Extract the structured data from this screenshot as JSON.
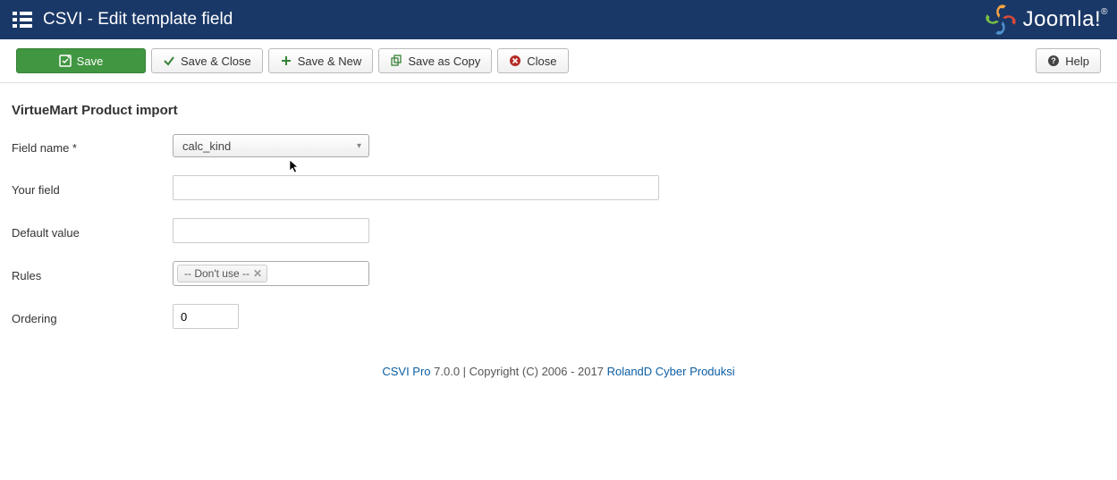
{
  "header": {
    "title": "CSVI - Edit template field",
    "brand": "Joomla!",
    "brand_r": "®"
  },
  "toolbar": {
    "save": "Save",
    "save_close": "Save & Close",
    "save_new": "Save & New",
    "save_copy": "Save as Copy",
    "close": "Close",
    "help": "Help"
  },
  "form": {
    "title": "VirtueMart Product import",
    "field_name_label": "Field name *",
    "field_name_value": "calc_kind",
    "your_field_label": "Your field",
    "your_field_value": "",
    "default_value_label": "Default value",
    "default_value": "",
    "rules_label": "Rules",
    "rules_tag": "-- Don't use --",
    "ordering_label": "Ordering",
    "ordering_value": "0"
  },
  "footer": {
    "link1": "CSVI Pro",
    "mid": " 7.0.0 | Copyright (C) 2006 - 2017 ",
    "link2": "RolandD Cyber Produksi"
  }
}
